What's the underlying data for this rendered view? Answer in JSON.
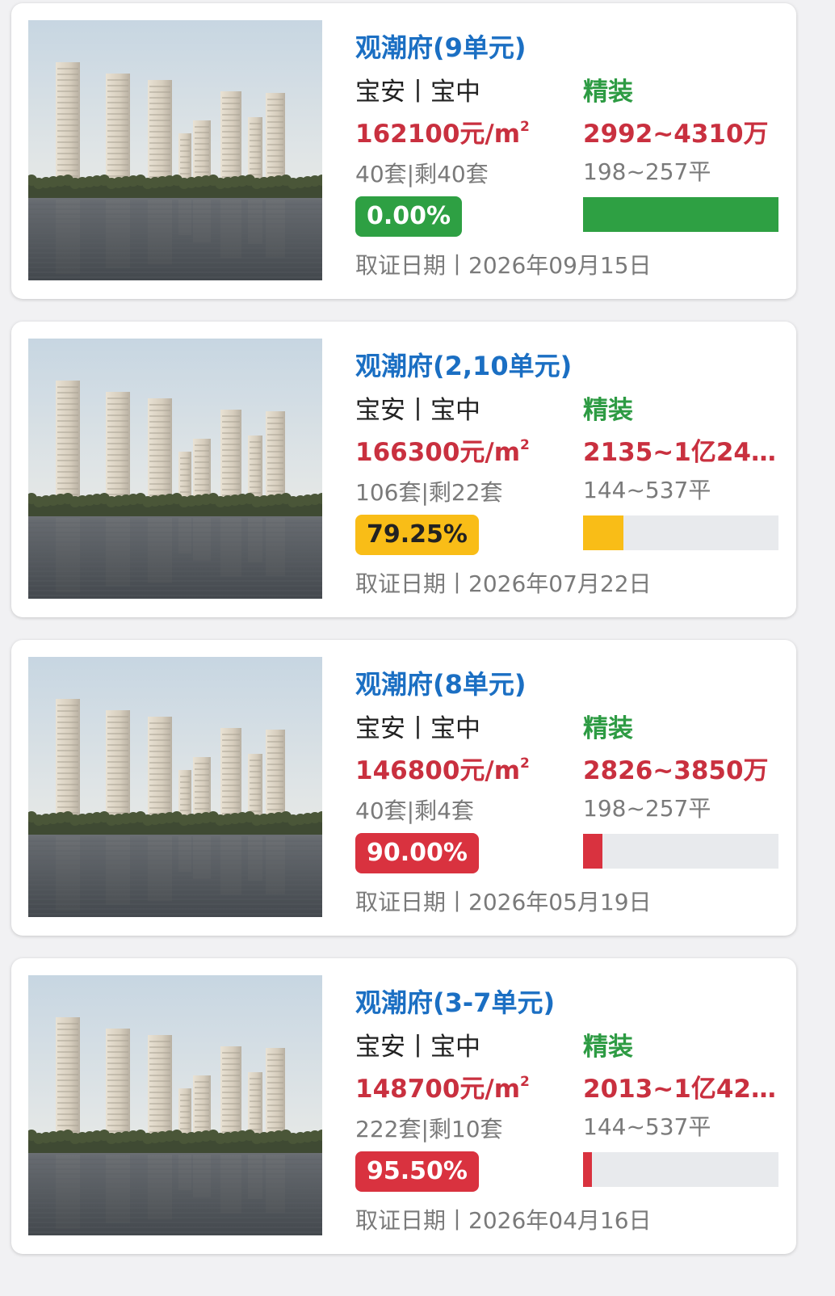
{
  "colors": {
    "title": "#1b6fc3",
    "price": "#c9303f",
    "decoration": "#2d9b43",
    "muted": "#7a7a7a",
    "bar_track": "#e8eaed"
  },
  "image_note": "render-image",
  "listings": [
    {
      "title": "观潮府(9单元)",
      "district": "宝安丨宝中",
      "decoration": "精装",
      "unit_price": "162100元/m",
      "unit_price_sup": "2",
      "total_price": "2992~4310万",
      "units": "40套|剩40套",
      "area": "198~257平",
      "sold_pct_label": "0.00%",
      "sold_fraction": 0.0,
      "badge_bg": "#2ea043",
      "badge_fg": "#ffffff",
      "bar_color": "#2ea043",
      "bar_fill_fraction": 1.0,
      "cert_date": "取证日期丨2026年09月15日"
    },
    {
      "title": "观潮府(2,10单元)",
      "district": "宝安丨宝中",
      "decoration": "精装",
      "unit_price": "166300元/m",
      "unit_price_sup": "2",
      "total_price": "2135~1亿24…",
      "units": "106套|剩22套",
      "area": "144~537平",
      "sold_pct_label": "79.25%",
      "sold_fraction": 0.7925,
      "badge_bg": "#f9bd17",
      "badge_fg": "#222222",
      "bar_color": "#f9bd17",
      "bar_fill_fraction": 0.2075,
      "cert_date": "取证日期丨2026年07月22日"
    },
    {
      "title": "观潮府(8单元)",
      "district": "宝安丨宝中",
      "decoration": "精装",
      "unit_price": "146800元/m",
      "unit_price_sup": "2",
      "total_price": "2826~3850万",
      "units": "40套|剩4套",
      "area": "198~257平",
      "sold_pct_label": "90.00%",
      "sold_fraction": 0.9,
      "badge_bg": "#d9323f",
      "badge_fg": "#ffffff",
      "bar_color": "#d9323f",
      "bar_fill_fraction": 0.1,
      "cert_date": "取证日期丨2026年05月19日"
    },
    {
      "title": "观潮府(3-7单元)",
      "district": "宝安丨宝中",
      "decoration": "精装",
      "unit_price": "148700元/m",
      "unit_price_sup": "2",
      "total_price": "2013~1亿42…",
      "units": "222套|剩10套",
      "area": "144~537平",
      "sold_pct_label": "95.50%",
      "sold_fraction": 0.955,
      "badge_bg": "#d9323f",
      "badge_fg": "#ffffff",
      "bar_color": "#d9323f",
      "bar_fill_fraction": 0.045,
      "cert_date": "取证日期丨2026年04月16日"
    }
  ]
}
